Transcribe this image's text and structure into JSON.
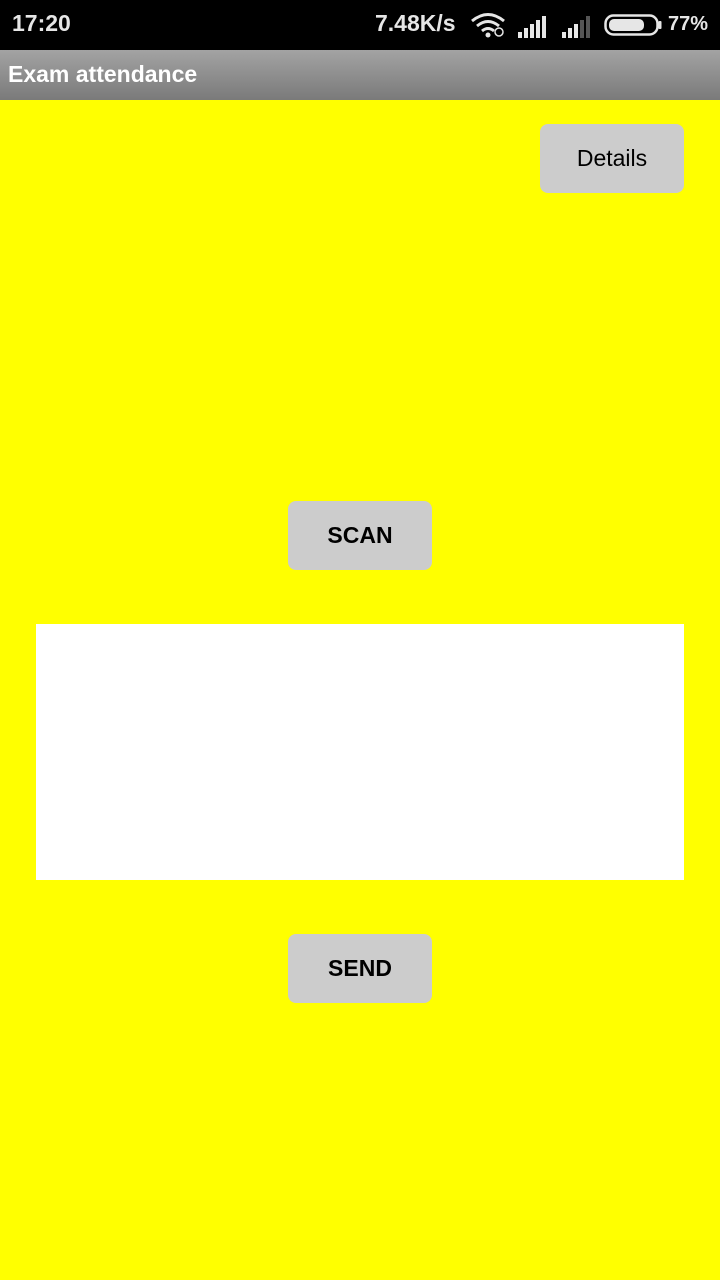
{
  "status_bar": {
    "time": "17:20",
    "network_speed": "7.48K/s",
    "battery_percent": "77%",
    "battery_level": 0.77,
    "icons": [
      "wifi-icon",
      "signal-icon",
      "signal-icon",
      "battery-icon"
    ]
  },
  "app_bar": {
    "title": "Exam attendance"
  },
  "main": {
    "details_label": "Details",
    "scan_label": "SCAN",
    "result_value": "",
    "send_label": "SEND"
  },
  "colors": {
    "background": "#ffff00",
    "button": "#cccccc",
    "app_bar": "#8c8c8c",
    "status_bar": "#000000"
  }
}
